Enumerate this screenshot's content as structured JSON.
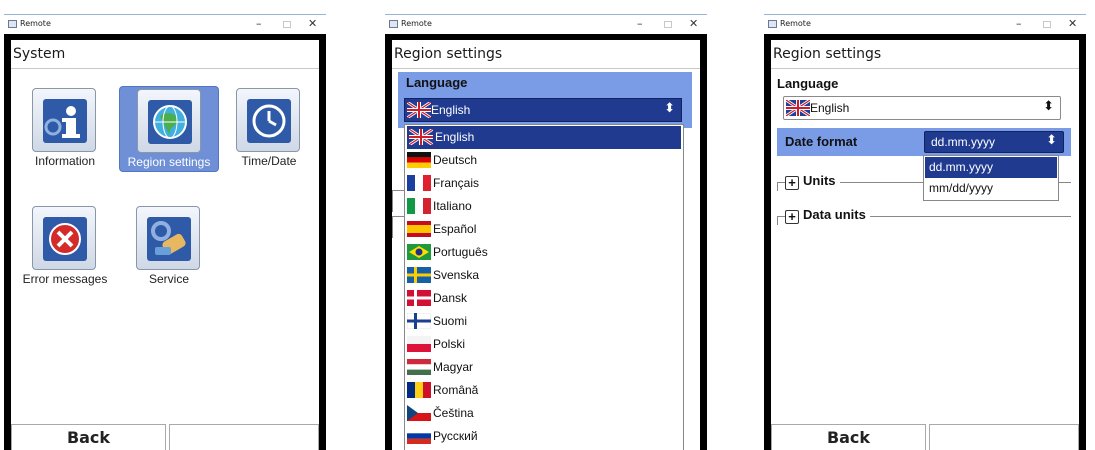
{
  "window_title": "Remote",
  "panels": [
    {
      "header": "System",
      "tiles": [
        {
          "label": "Information",
          "icon": "information-icon"
        },
        {
          "label": "Region settings",
          "icon": "globe-icon",
          "selected": true
        },
        {
          "label": "Time/Date",
          "icon": "clock-icon"
        },
        {
          "label": "Error messages",
          "icon": "error-icon"
        },
        {
          "label": "Service",
          "icon": "service-icon"
        }
      ],
      "back_label": "Back"
    },
    {
      "header": "Region settings",
      "language_label": "Language",
      "language_value": "English",
      "languages": [
        "English",
        "Deutsch",
        "Français",
        "Italiano",
        "Español",
        "Português",
        "Svenska",
        "Dansk",
        "Suomi",
        "Polski",
        "Magyar",
        "Română",
        "Čeština",
        "Русский"
      ]
    },
    {
      "header": "Region settings",
      "language_label": "Language",
      "language_value": "English",
      "date_format_label": "Date format",
      "date_format_value": "dd.mm.yyyy",
      "date_formats": [
        "dd.mm.yyyy",
        "mm/dd/yyyy"
      ],
      "units_label": "Units",
      "data_units_label": "Data units",
      "back_label": "Back"
    }
  ],
  "colors": {
    "selection": "#1f3a8f",
    "highlight": "#7a9be6",
    "tile_selected": "#6f8fd6"
  }
}
